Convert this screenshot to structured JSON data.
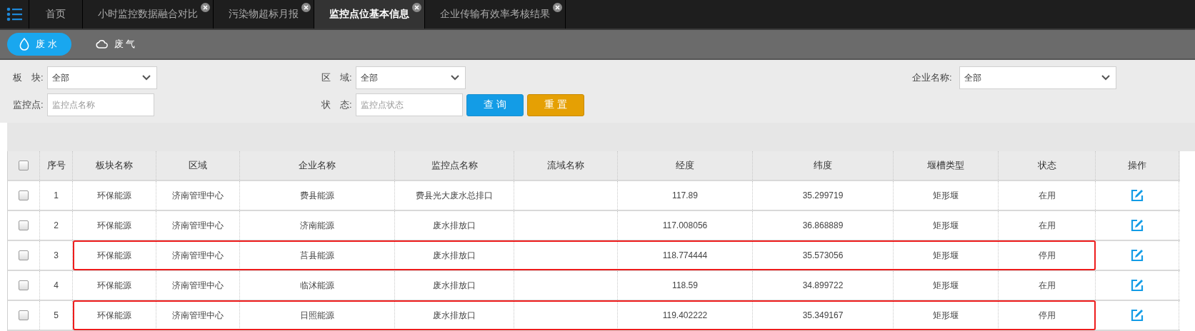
{
  "tabs": [
    {
      "label": "首页",
      "selected": false,
      "closable": false
    },
    {
      "label": "小时监控数据融合对比",
      "selected": false,
      "closable": true
    },
    {
      "label": "污染物超标月报",
      "selected": false,
      "closable": true
    },
    {
      "label": "监控点位基本信息",
      "selected": true,
      "closable": true
    },
    {
      "label": "企业传输有效率考核结果",
      "selected": false,
      "closable": true
    }
  ],
  "subtabs": [
    {
      "label": "废 水",
      "selected": true
    },
    {
      "label": "废 气",
      "selected": false
    }
  ],
  "filters": {
    "rows": [
      [
        {
          "kind": "select",
          "label": "板　块:",
          "value": "全部"
        },
        {
          "kind": "select",
          "label": "区　域:",
          "value": "全部"
        },
        {
          "kind": "select",
          "label": "企业名称:",
          "value": "全部"
        }
      ],
      [
        {
          "kind": "input",
          "label": "监控点:",
          "placeholder": "监控点名称"
        },
        {
          "kind": "input",
          "label": "状　态:",
          "placeholder": "监控点状态"
        }
      ]
    ],
    "buttons": [
      {
        "label": "查 询",
        "kind": "primary"
      },
      {
        "label": "重 置",
        "kind": "warning"
      }
    ]
  },
  "table": {
    "header_checked": false,
    "columns": [
      "序号",
      "板块名称",
      "区域",
      "企业名称",
      "监控点名称",
      "流域名称",
      "经度",
      "纬度",
      "堰槽类型",
      "状态",
      "操作"
    ],
    "rows": [
      {
        "checked": false,
        "highlighted": false,
        "cells": [
          "1",
          "环保能源",
          "济南管理中心",
          "费县能源",
          "费县光大废水总排口",
          "",
          "117.89",
          "35.299719",
          "矩形堰",
          "在用"
        ]
      },
      {
        "checked": false,
        "highlighted": false,
        "cells": [
          "2",
          "环保能源",
          "济南管理中心",
          "济南能源",
          "废水排放口",
          "",
          "117.008056",
          "36.868889",
          "矩形堰",
          "在用"
        ]
      },
      {
        "checked": false,
        "highlighted": true,
        "cells": [
          "3",
          "环保能源",
          "济南管理中心",
          "莒县能源",
          "废水排放口",
          "",
          "118.774444",
          "35.573056",
          "矩形堰",
          "停用"
        ]
      },
      {
        "checked": false,
        "highlighted": false,
        "cells": [
          "4",
          "环保能源",
          "济南管理中心",
          "临沭能源",
          "废水排放口",
          "",
          "118.59",
          "34.899722",
          "矩形堰",
          "在用"
        ]
      },
      {
        "checked": false,
        "highlighted": true,
        "cells": [
          "5",
          "环保能源",
          "济南管理中心",
          "日照能源",
          "废水排放口",
          "",
          "119.402222",
          "35.349167",
          "矩形堰",
          "停用"
        ]
      }
    ]
  }
}
